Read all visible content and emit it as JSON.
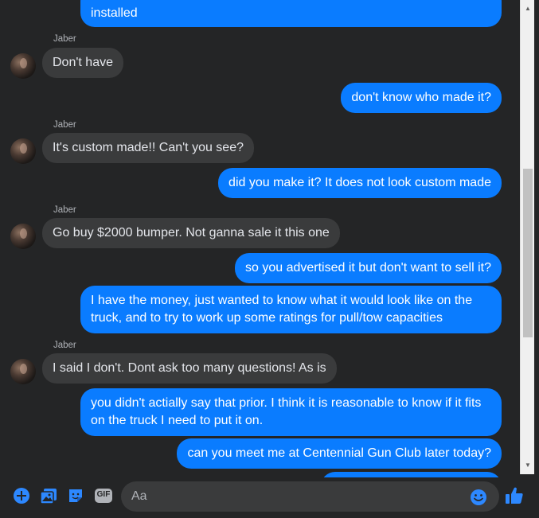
{
  "conversation": {
    "sender_name": "Jaber",
    "messages": [
      {
        "from": "me",
        "text": "installed"
      },
      {
        "from": "them",
        "text": "Don't have"
      },
      {
        "from": "me",
        "text": "don't know who made it?"
      },
      {
        "from": "them",
        "text": "It's custom made!! Can't you see?"
      },
      {
        "from": "me",
        "text": "did you make it?  It does not look custom made"
      },
      {
        "from": "them",
        "text": "Go buy $2000 bumper. Not ganna sale it this one"
      },
      {
        "from": "me",
        "text": "so you advertised it but don't want to sell it?"
      },
      {
        "from": "me",
        "text": "I have the money, just wanted to know what it would look like on the truck, and to try to work up some ratings for pull/tow capacities"
      },
      {
        "from": "them",
        "text": "I said I don't. Dont ask too many questions!  As is"
      },
      {
        "from": "me",
        "text": "you didn't actially say that prior.  I think it is reasonable to know if it fits on the truck I need to put it on."
      },
      {
        "from": "me",
        "text": "can you meet me at Centennial Gun Club later today?"
      }
    ]
  },
  "composer": {
    "placeholder": "Aa",
    "gif_label": "GIF",
    "icons": [
      "plus-icon",
      "photo-icon",
      "sticker-icon",
      "gif-icon",
      "emoji-icon",
      "thumbs-up-icon"
    ]
  },
  "colors": {
    "background": "#242526",
    "outgoing_bubble": "#0a7cff",
    "incoming_bubble": "#3a3b3c",
    "accent": "#0a7cff"
  }
}
